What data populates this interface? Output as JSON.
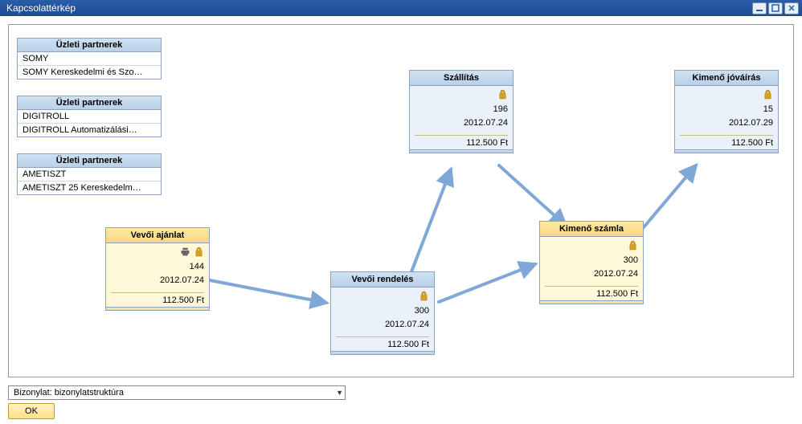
{
  "window": {
    "title": "Kapcsolattérkép"
  },
  "partners": {
    "header": "Üzleti partnerek",
    "list": [
      {
        "code": "SOMY",
        "name": "SOMY Kereskedelmi és Szo…"
      },
      {
        "code": "DIGITROLL",
        "name": "DIGITROLL Automatizálási…"
      },
      {
        "code": "AMETISZT",
        "name": "AMETISZT 25 Kereskedelm…"
      }
    ]
  },
  "docs": {
    "offer": {
      "title": "Vevői ajánlat",
      "num": "144",
      "date": "2012.07.24",
      "total": "112.500 Ft"
    },
    "order": {
      "title": "Vevői rendelés",
      "num": "300",
      "date": "2012.07.24",
      "total": "112.500 Ft"
    },
    "deliv": {
      "title": "Szállítás",
      "num": "196",
      "date": "2012.07.24",
      "total": "112.500 Ft"
    },
    "invoice": {
      "title": "Kimenő számla",
      "num": "300",
      "date": "2012.07.24",
      "total": "112.500 Ft"
    },
    "credit": {
      "title": "Kimenő jóváírás",
      "num": "15",
      "date": "2012.07.29",
      "total": "112.500 Ft"
    }
  },
  "chart_data": {
    "type": "flow",
    "nodes": [
      {
        "id": "offer",
        "label": "Vevői ajánlat",
        "num": 144,
        "date": "2012.07.24",
        "total_ft": 112500
      },
      {
        "id": "order",
        "label": "Vevői rendelés",
        "num": 300,
        "date": "2012.07.24",
        "total_ft": 112500
      },
      {
        "id": "deliv",
        "label": "Szállítás",
        "num": 196,
        "date": "2012.07.24",
        "total_ft": 112500
      },
      {
        "id": "invoice",
        "label": "Kimenő számla",
        "num": 300,
        "date": "2012.07.24",
        "total_ft": 112500
      },
      {
        "id": "credit",
        "label": "Kimenő jóváírás",
        "num": 15,
        "date": "2012.07.29",
        "total_ft": 112500
      }
    ],
    "edges": [
      [
        "offer",
        "order"
      ],
      [
        "order",
        "deliv"
      ],
      [
        "order",
        "invoice"
      ],
      [
        "deliv",
        "invoice"
      ],
      [
        "invoice",
        "credit"
      ]
    ]
  },
  "bottom": {
    "select_value": "Bizonylat: bizonylatstruktúra",
    "ok": "OK"
  }
}
